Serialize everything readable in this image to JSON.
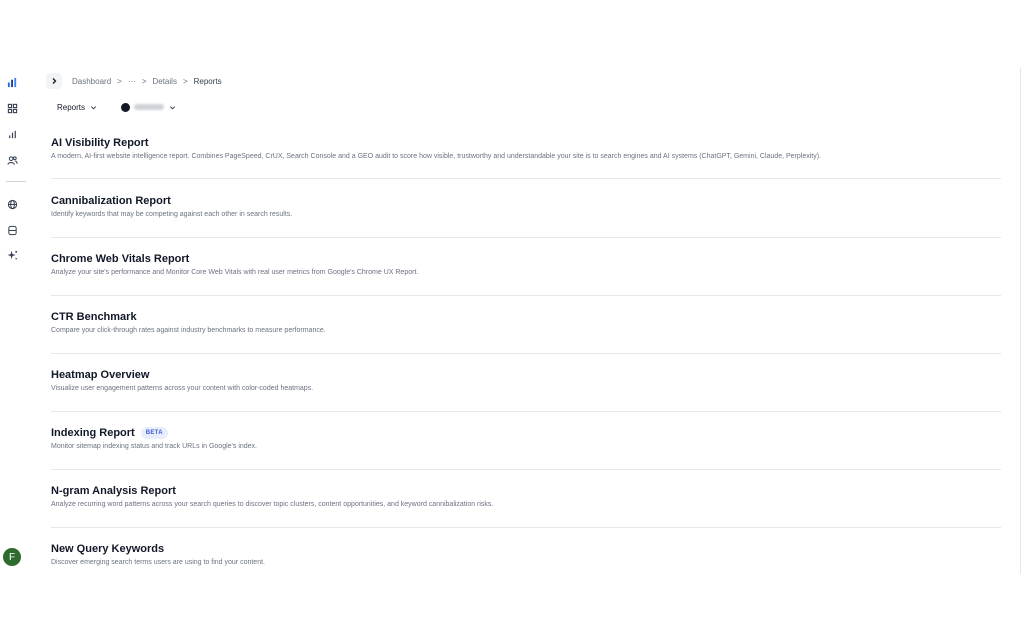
{
  "sidebar": {
    "icons": [
      "logo-icon",
      "dashboard-grid-icon",
      "bar-chart-icon",
      "users-icon",
      "globe-icon",
      "database-icon",
      "sparkle-icon"
    ],
    "avatar_initial": "F",
    "avatar_color": "#2f6b2f"
  },
  "breadcrumb": {
    "items": [
      "Dashboard",
      "···",
      "Details",
      "Reports"
    ],
    "separator": ">"
  },
  "filters": {
    "reports_label": "Reports"
  },
  "reports": [
    {
      "title": "AI Visibility Report",
      "description": "A modern, AI-first website intelligence report. Combines PageSpeed, CrUX, Search Console and a GEO audit to score how visible, trustworthy and understandable your site is to search engines and AI systems (ChatGPT, Gemini, Claude, Perplexity).",
      "badge": ""
    },
    {
      "title": "Cannibalization Report",
      "description": "Identify keywords that may be competing against each other in search results.",
      "badge": ""
    },
    {
      "title": "Chrome Web Vitals Report",
      "description": "Analyze your site's performance and Monitor Core Web Vitals with real user metrics from Google's Chrome UX Report.",
      "badge": ""
    },
    {
      "title": "CTR Benchmark",
      "description": "Compare your click-through rates against industry benchmarks to measure performance.",
      "badge": ""
    },
    {
      "title": "Heatmap Overview",
      "description": "Visualize user engagement patterns across your content with color-coded heatmaps.",
      "badge": ""
    },
    {
      "title": "Indexing Report",
      "description": "Monitor sitemap indexing status and track URLs in Google's index.",
      "badge": "BETA"
    },
    {
      "title": "N-gram Analysis Report",
      "description": "Analyze recurring word patterns across your search queries to discover topic clusters, content opportunities, and keyword cannibalization risks.",
      "badge": ""
    },
    {
      "title": "New Query Keywords",
      "description": "Discover emerging search terms users are using to find your content.",
      "badge": ""
    }
  ],
  "colors": {
    "accent": "#3b5bdb",
    "badge_bg": "#e8eefc",
    "text_primary": "#111827",
    "text_secondary": "#6b7280"
  }
}
